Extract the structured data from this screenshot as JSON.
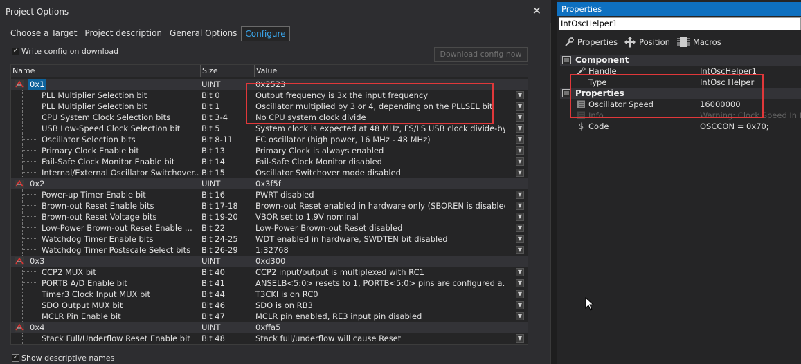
{
  "dialog": {
    "title": "Project Options",
    "close_glyph": "✕",
    "tabs": [
      {
        "label": "Choose a Target",
        "active": false
      },
      {
        "label": "Project description",
        "active": false
      },
      {
        "label": "General Options",
        "active": false
      },
      {
        "label": "Configure",
        "active": true
      }
    ],
    "write_config_label": "Write config on download",
    "write_config_checked": true,
    "download_button_label": "Download config now",
    "download_button_enabled": false,
    "show_descriptive_label": "Show descriptive names",
    "show_descriptive_checked": true,
    "columns": {
      "name": "Name",
      "size": "Size",
      "value": "Value"
    },
    "rows": [
      {
        "kind": "group",
        "name": "0x1",
        "size": "UINT",
        "value": "0x2523",
        "selected": true
      },
      {
        "kind": "child",
        "name": "PLL Multiplier Selection bit",
        "size": "Bit 0",
        "value": "Output frequency is 3x the input frequency"
      },
      {
        "kind": "child",
        "name": "PLL Multiplier Selection bit",
        "size": "Bit 1",
        "value": " Oscillator multiplied by 3 or 4, depending on the PLLSEL bit"
      },
      {
        "kind": "child",
        "name": "CPU System Clock Selection bits",
        "size": "Bit 3-4",
        "value": "No CPU system clock divide"
      },
      {
        "kind": "child",
        "name": "USB Low-Speed Clock Selection bit",
        "size": "Bit 5",
        "value": "System clock is expected at 48 MHz, FS/LS USB clock divide-by..."
      },
      {
        "kind": "child",
        "name": "Oscillator Selection bits",
        "size": "Bit 8-11",
        "value": "EC oscillator (high power, 16 MHz - 48 MHz)"
      },
      {
        "kind": "child",
        "name": "Primary Clock Enable bit",
        "size": "Bit 13",
        "value": "Primary Clock is always enabled"
      },
      {
        "kind": "child",
        "name": "Fail-Safe Clock Monitor Enable bit",
        "size": "Bit 14",
        "value": "Fail-Safe Clock Monitor disabled"
      },
      {
        "kind": "child",
        "name": "Internal/External Oscillator Switchover...",
        "size": "Bit 15",
        "value": "Oscillator Switchover mode disabled"
      },
      {
        "kind": "group",
        "name": "0x2",
        "size": "UINT",
        "value": "0x3f5f",
        "selected": false
      },
      {
        "kind": "child",
        "name": "Power-up Timer Enable bit",
        "size": "Bit 16",
        "value": "PWRT disabled"
      },
      {
        "kind": "child",
        "name": "Brown-out Reset Enable bits",
        "size": "Bit 17-18",
        "value": "Brown-out Reset enabled in hardware only (SBOREN is disabled)"
      },
      {
        "kind": "child",
        "name": "Brown-out Reset Voltage bits",
        "size": "Bit 19-20",
        "value": "VBOR set to 1.9V nominal"
      },
      {
        "kind": "child",
        "name": "Low-Power Brown-out Reset Enable ...",
        "size": "Bit 22",
        "value": "Low-Power Brown-out Reset disabled"
      },
      {
        "kind": "child",
        "name": "Watchdog Timer Enable bits",
        "size": "Bit 24-25",
        "value": "WDT enabled in hardware, SWDTEN bit disabled"
      },
      {
        "kind": "child",
        "name": "Watchdog Timer Postscale Select bits",
        "size": "Bit 26-29",
        "value": "1:32768"
      },
      {
        "kind": "group",
        "name": "0x3",
        "size": "UINT",
        "value": "0xd300",
        "selected": false
      },
      {
        "kind": "child",
        "name": "CCP2 MUX bit",
        "size": "Bit 40",
        "value": "CCP2 input/output is multiplexed with RC1"
      },
      {
        "kind": "child",
        "name": "PORTB A/D Enable bit",
        "size": "Bit 41",
        "value": "ANSELB<5:0> resets to 1, PORTB<5:0> pins are configured a..."
      },
      {
        "kind": "child",
        "name": "Timer3 Clock Input MUX bit",
        "size": "Bit 44",
        "value": "T3CKI is on RC0"
      },
      {
        "kind": "child",
        "name": "SDO Output MUX bit",
        "size": "Bit 46",
        "value": "SDO is on RB3"
      },
      {
        "kind": "child",
        "name": "MCLR Pin Enable bit",
        "size": "Bit 47",
        "value": "MCLR pin enabled, RE3 input pin disabled"
      },
      {
        "kind": "group",
        "name": "0x4",
        "size": "UINT",
        "value": "0xffa5",
        "selected": false
      },
      {
        "kind": "child",
        "name": "Stack Full/Underflow Reset Enable bit",
        "size": "Bit 48",
        "value": "Stack full/underflow will cause Reset"
      }
    ]
  },
  "properties": {
    "title": "Properties",
    "object_name": "IntOscHelper1",
    "toolbar": {
      "properties": "Properties",
      "position": "Position",
      "macros": "Macros"
    },
    "rows": [
      {
        "kind": "cat",
        "name": "Component"
      },
      {
        "kind": "prop",
        "icon": "wrench-icon",
        "name": "Handle",
        "value": "IntOscHelper1"
      },
      {
        "kind": "prop",
        "icon": "none",
        "name": "Type",
        "value": "IntOsc Helper"
      },
      {
        "kind": "cat",
        "name": "Properties"
      },
      {
        "kind": "prop",
        "icon": "list-icon",
        "name": "Oscillator Speed",
        "value": "16000000"
      },
      {
        "kind": "prop",
        "icon": "list-icon",
        "name": "Info",
        "value": "Warning: Clock Speed In P",
        "dim": true
      },
      {
        "kind": "prop",
        "icon": "dollar-icon",
        "name": "Code",
        "value": "OSCCON = 0x70;"
      }
    ]
  },
  "colors": {
    "accent_blue": "#0e70c0",
    "tab_active_text": "#3ba9f0",
    "highlight_red": "#e0383a"
  }
}
